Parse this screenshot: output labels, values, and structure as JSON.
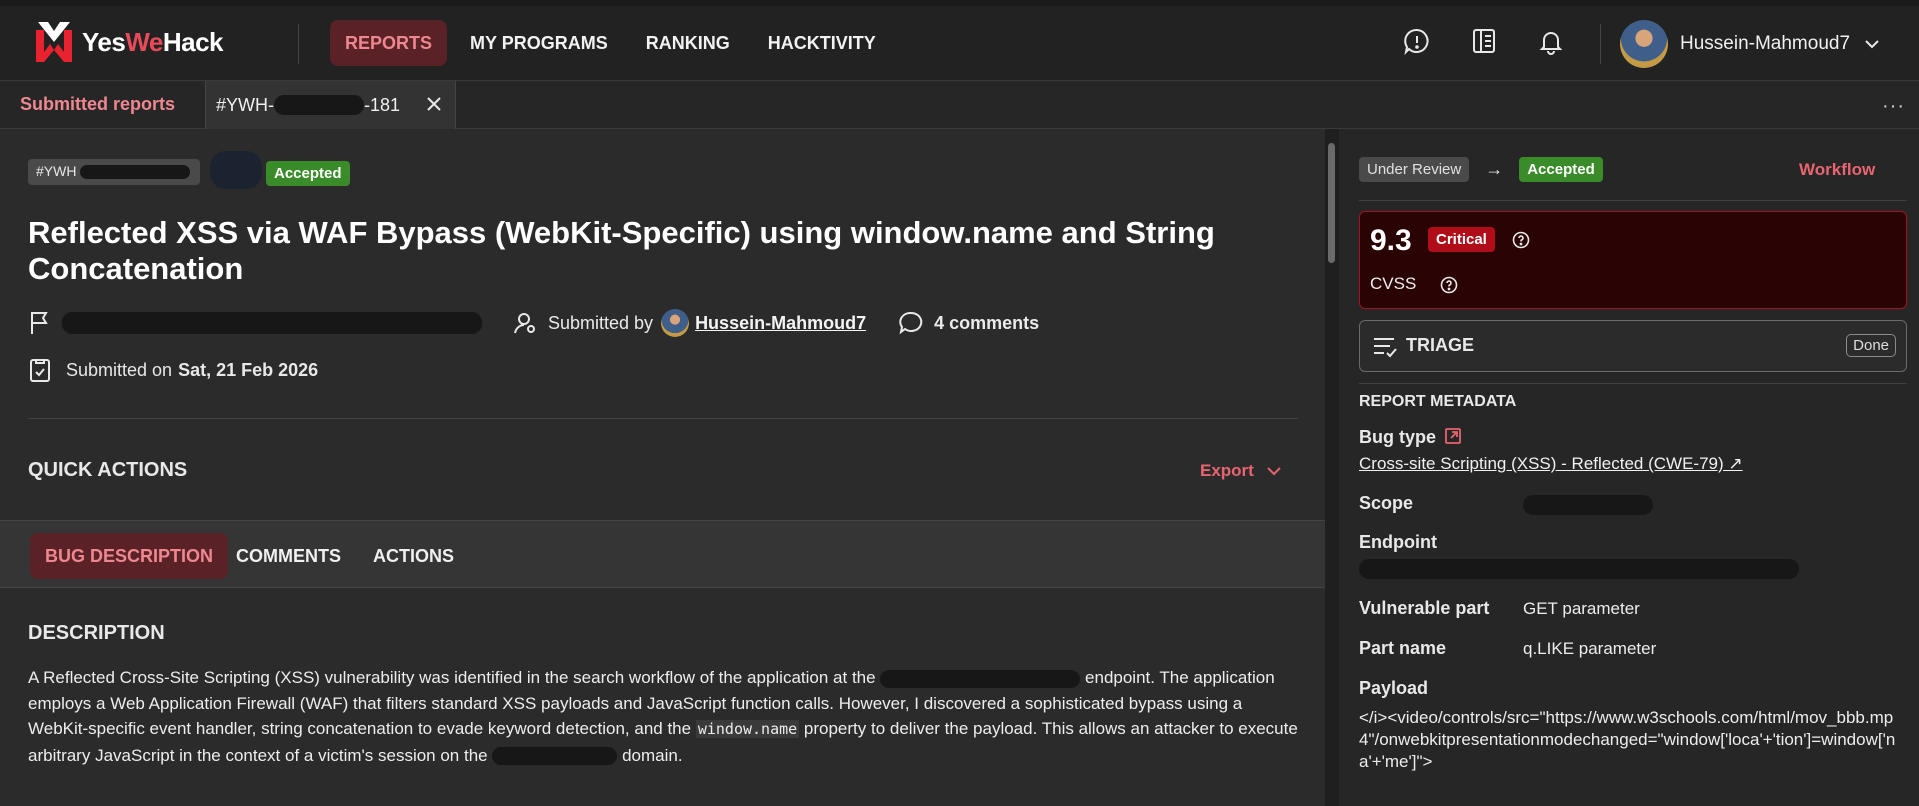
{
  "app": {
    "logo_yes": "Yes",
    "logo_we": "We",
    "logo_hack": "Hack",
    "accent": "#e8656f",
    "critical_color": "#b00d18",
    "accepted_color": "#3a8c2a"
  },
  "nav": {
    "items": [
      {
        "label": "REPORTS",
        "active": true
      },
      {
        "label": "MY PROGRAMS",
        "active": false
      },
      {
        "label": "RANKING",
        "active": false
      },
      {
        "label": "HACKTIVITY",
        "active": false
      }
    ],
    "icons": [
      "help-circle-icon",
      "book-icon",
      "bell-icon"
    ],
    "user": "Hussein-Mahmoud7"
  },
  "tabs": {
    "submitted": "Submitted reports",
    "open_tab_prefix": "#YWH-",
    "open_tab_suffix": "-181"
  },
  "report": {
    "id_prefix": "#YWH",
    "status_badge": "Accepted",
    "title": "Reflected XSS via WAF Bypass (WebKit-Specific) using window.name and String Concatenation",
    "submitted_by_label": "Submitted by",
    "submitted_by": "Hussein-Mahmoud7",
    "comments": "4 comments",
    "submitted_on_label": "Submitted on",
    "submitted_on_date": "Sat, 21 Feb 2026",
    "quick_actions": "QUICK ACTIONS",
    "export": "Export",
    "subtabs": [
      "BUG DESCRIPTION",
      "COMMENTS",
      "ACTIONS"
    ],
    "description_title": "DESCRIPTION",
    "description_p1": "A Reflected Cross-Site Scripting (XSS) vulnerability was identified in the search workflow of the application at the ",
    "description_p2": " endpoint. The application employs a Web Application Firewall (WAF) that filters standard XSS payloads and JavaScript function calls. However, I discovered a sophisticated bypass using a WebKit-specific event handler, string concatenation to evade keyword detection, and the ",
    "description_code": "window.name",
    "description_p3": " property to deliver the payload. This allows an attacker to execute arbitrary JavaScript in the context of a victim's session on the ",
    "description_p4": " domain."
  },
  "side": {
    "status_from": "Under Review",
    "status_to": "Accepted",
    "workflow": "Workflow",
    "cvss_score": "9.3",
    "cvss_severity": "Critical",
    "cvss_label": "CVSS",
    "triage": "TRIAGE",
    "triage_done": "Done",
    "metadata_title": "REPORT METADATA",
    "bug_type_label": "Bug type",
    "bug_type_value": "Cross-site Scripting (XSS) - Reflected (CWE-79) ↗",
    "scope_label": "Scope",
    "endpoint_label": "Endpoint",
    "vuln_part_label": "Vulnerable part",
    "vuln_part_value": "GET parameter",
    "part_name_label": "Part name",
    "part_name_value": "q.LIKE parameter",
    "payload_label": "Payload",
    "payload_value": "</i><video/controls/src=\"https://www.w3schools.com/html/mov_bbb.mp4\"/onwebkitpresentationmodechanged=\"window['loca'+'tion']=window['na'+'me']\">"
  }
}
